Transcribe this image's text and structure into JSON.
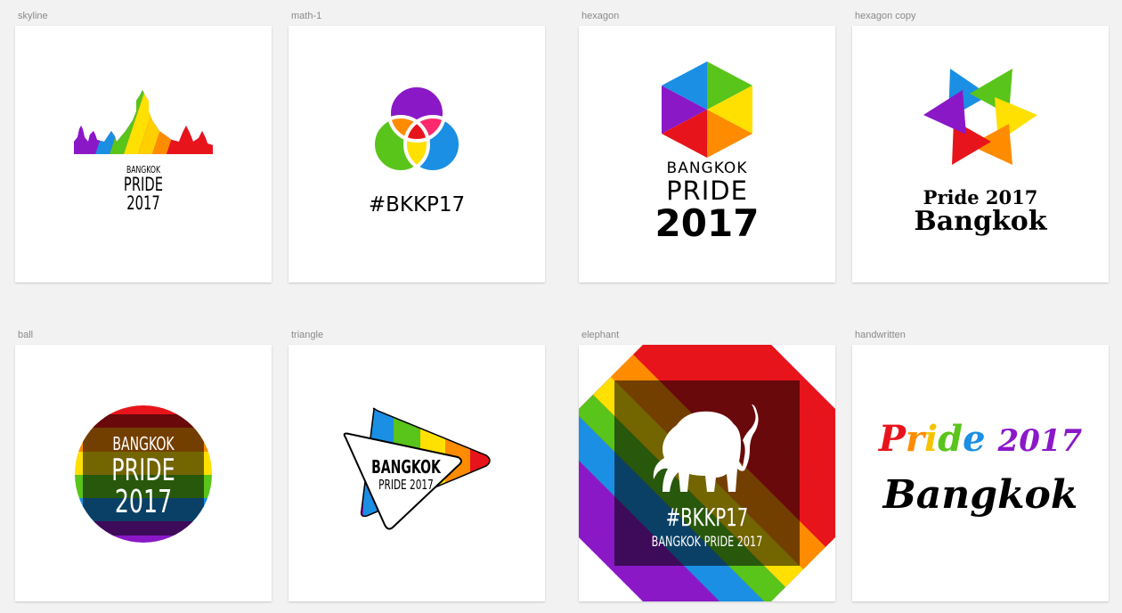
{
  "artboards": [
    {
      "label": "skyline",
      "logo": {
        "line1": "BANGKOK",
        "line2": "PRIDE",
        "line3": "2017"
      }
    },
    {
      "label": "math-1",
      "logo": {
        "line1": "#BKKP17"
      }
    },
    {
      "label": "hexagon",
      "logo": {
        "line1": "BANGKOK",
        "line2": "PRIDE",
        "line3": "2017"
      }
    },
    {
      "label": "hexagon copy",
      "logo": {
        "line1": "Pride 2017",
        "line2": "Bangkok"
      }
    },
    {
      "label": "ball",
      "logo": {
        "line1": "BANGKOK",
        "line2": "PRIDE",
        "line3": "2017"
      }
    },
    {
      "label": "triangle",
      "logo": {
        "line1": "BANGKOK",
        "line2": "PRIDE 2017"
      }
    },
    {
      "label": "elephant",
      "logo": {
        "line1": "#BKKP17",
        "line2": "BANGKOK PRIDE 2017"
      }
    },
    {
      "label": "handwritten",
      "logo": {
        "line1_letters": [
          "P",
          "r",
          "i",
          "d",
          "e"
        ],
        "line1_suffix": "2017",
        "line2": "Bangkok"
      }
    }
  ],
  "colors": {
    "red": "#e8141b",
    "orange": "#ff8c00",
    "yellow": "#ffe000",
    "green": "#59c41a",
    "blue": "#1a8fe3",
    "purple": "#8a18c7",
    "canvas": "#f2f2f2",
    "label": "#8a8a8a"
  }
}
